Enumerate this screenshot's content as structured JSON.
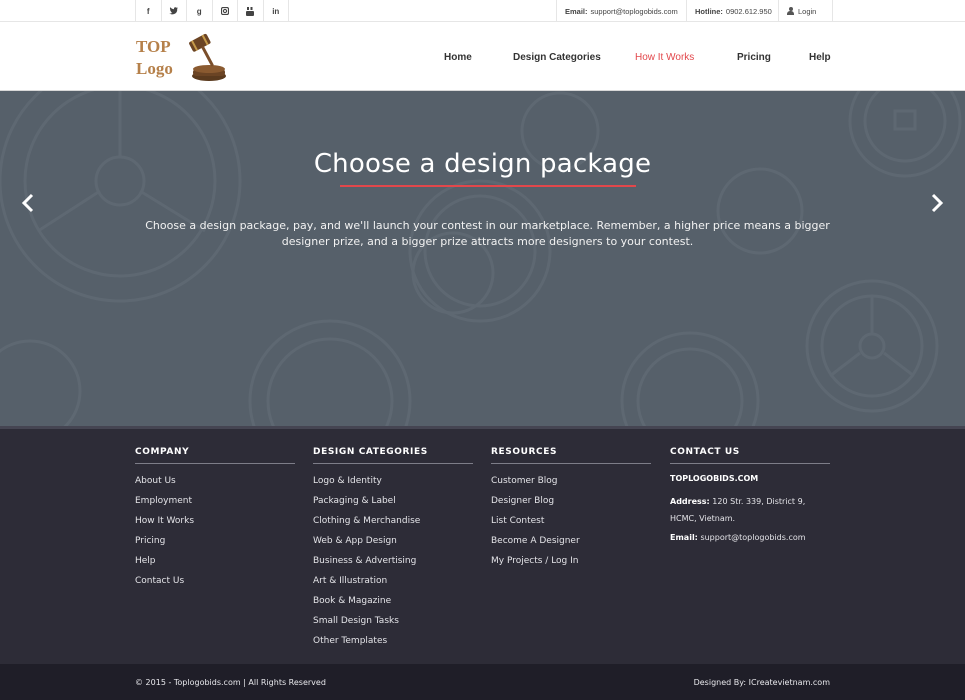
{
  "topbar": {
    "social": [
      {
        "icon": "facebook-icon",
        "glyph": "f"
      },
      {
        "icon": "twitter-icon",
        "glyph": "🐦"
      },
      {
        "icon": "google-plus-icon",
        "glyph": "g"
      },
      {
        "icon": "instagram-icon",
        "glyph": "◙"
      },
      {
        "icon": "youtube-icon",
        "glyph": "▣"
      },
      {
        "icon": "linkedin-icon",
        "glyph": "in"
      }
    ],
    "email_label": "Email:",
    "email_value": "support@toplogobids.com",
    "hotline_label": "Hotline:",
    "hotline_value": "0902.612.950",
    "login_label": "Login"
  },
  "header": {
    "logo_line1": "TOP",
    "logo_line2": "Logo",
    "nav": [
      {
        "label": "Home"
      },
      {
        "label": "Design Categories"
      },
      {
        "label": "How It Works",
        "active": true
      },
      {
        "label": "Pricing"
      },
      {
        "label": "Help"
      }
    ]
  },
  "hero": {
    "title": "Choose a design package",
    "text": "Choose a design package, pay, and we'll launch your contest in our marketplace. Remember, a higher price means a bigger designer prize, and a bigger prize attracts more designers to your contest."
  },
  "footer": {
    "company": {
      "heading": "COMPANY",
      "items": [
        "About Us",
        "Employment",
        "How It Works",
        "Pricing",
        "Help",
        "Contact Us"
      ]
    },
    "categories": {
      "heading": "DESIGN CATEGORIES",
      "items": [
        "Logo & Identity",
        "Packaging & Label",
        "Clothing & Merchandise",
        "Web & App Design",
        "Business & Advertising",
        "Art & Illustration",
        "Book & Magazine",
        "Small Design Tasks",
        "Other Templates"
      ]
    },
    "resources": {
      "heading": "RESOURCES",
      "items": [
        "Customer Blog",
        "Designer Blog",
        "List Contest",
        "Become A Designer",
        "My Projects / Log In"
      ]
    },
    "contact": {
      "heading": "CONTACT US",
      "brand": "TOPLOGOBIDS.COM",
      "address_label": "Address:",
      "address_value": "120 Str. 339, District 9, HCMC, Vietnam.",
      "email_label": "Email:",
      "email_value": "support@toplogobids.com"
    }
  },
  "bottom": {
    "copyright": "© 2015 - Toplogobids.com | All Rights Reserved",
    "designed_by": "Designed By: ICreatevietnam.com"
  },
  "colors": {
    "accent": "#e2474b",
    "hero_bg": "#56606a",
    "footer_bg": "#2d2c37",
    "bottom_bg": "#1f1e28",
    "logo_brown": "#b5804a"
  }
}
